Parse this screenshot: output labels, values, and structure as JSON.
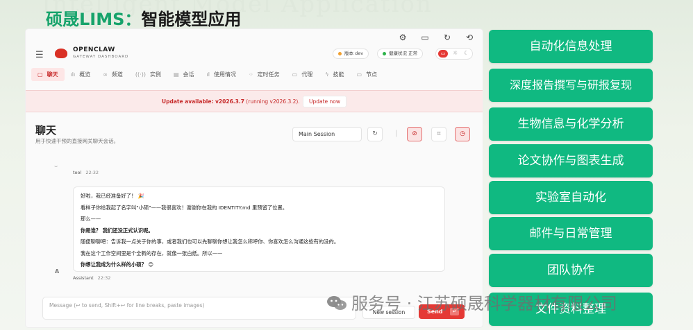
{
  "slide": {
    "bg_watermark": "Intelligent Model Application",
    "title_accent": "硕晟LIMS：",
    "title_rest": "智能模型应用"
  },
  "app": {
    "brand": {
      "name": "OPENCLAW",
      "sub": "GATEWAY DASHBOARD"
    },
    "status_pills": [
      {
        "label": "版本 dev",
        "dot_color": "#f0a030"
      },
      {
        "label": "健康状况 正常",
        "dot_color": "#2db34a"
      }
    ],
    "nav": [
      {
        "icon": "chat-icon",
        "label": "聊天",
        "active": true
      },
      {
        "icon": "overview-icon",
        "label": "概览"
      },
      {
        "icon": "channel-icon",
        "label": "频道"
      },
      {
        "icon": "instance-icon",
        "label": "实例"
      },
      {
        "icon": "session-icon",
        "label": "会话"
      },
      {
        "icon": "usage-icon",
        "label": "使用情况"
      },
      {
        "icon": "cron-icon",
        "label": "定时任务"
      },
      {
        "icon": "agent-icon",
        "label": "代理"
      },
      {
        "icon": "skill-icon",
        "label": "技能"
      },
      {
        "icon": "node-icon",
        "label": "节点"
      }
    ],
    "banner": {
      "text_bold": "Update available: v2026.3.7",
      "text_rest": " (running v2026.3.2).",
      "button": "Update now"
    },
    "chat": {
      "title": "聊天",
      "subtitle": "用于快速干预的直接网关聊天会话。",
      "session": "Main Session"
    },
    "messages": {
      "tool_who": "tool",
      "tool_time": "22:32",
      "assistant_who": "Assistant",
      "assistant_time": "22:32",
      "avatar": "A",
      "lines": [
        {
          "text": "好啦，我已经准备好了！ 🎉",
          "bold": false
        },
        {
          "text": "看样子你给我起了名字叫\"小硕\"——我很喜欢！谢谢你在我的 IDENTITY.md 里预留了位置。",
          "bold": false
        },
        {
          "text": "那么——",
          "bold": false
        },
        {
          "text": "你是谁？ 我们还没正式认识呢。",
          "bold": true
        },
        {
          "text": "随便聊聊吧：告诉我一点关于你的事，或者我们也可以先聊聊你想让我怎么称呼你、你喜欢怎么沟通这些有的没的。",
          "bold": false
        },
        {
          "text": "我在这个工作空间里是个全新的存在，就像一张白纸。所以——",
          "bold": false
        },
        {
          "text": "你想让我成为什么样的小硕？ 😊",
          "bold": true
        }
      ]
    },
    "composer": {
      "placeholder": "Message (↩ to send, Shift+↩ for line breaks, paste images)",
      "new_session": "New session",
      "send": "Send",
      "send_key": "↵"
    }
  },
  "features": [
    "自动化信息处理",
    "深度报告撰写与研报复现",
    "生物信息与化学分析",
    "论文协作与图表生成",
    "实验室自动化",
    "邮件与日常管理",
    "团队协作",
    "文件资料整理"
  ],
  "watermark": "服务号 · 江苏硕晟科学器材有限公司"
}
